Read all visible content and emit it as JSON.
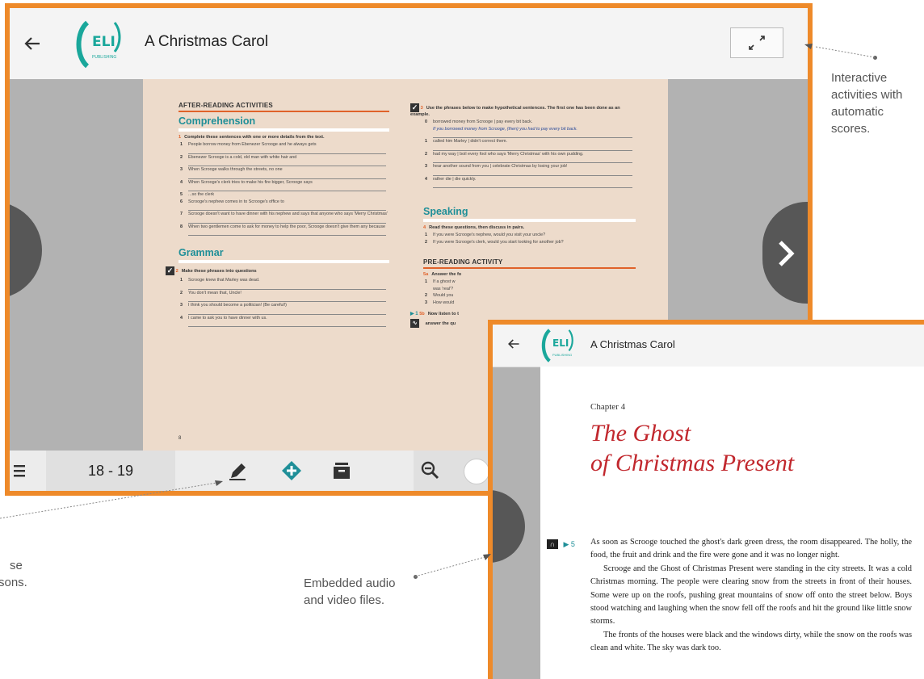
{
  "colors": {
    "frame": "#ee8a2a",
    "teal": "#1f8f98",
    "orange": "#e0622a",
    "ghost_red": "#c1272d"
  },
  "main_window": {
    "title": "A Christmas Carol",
    "back_icon": "arrow-left-icon",
    "logo_text": "ELI",
    "logo_sub": "PUBLISHING",
    "minimize_icon": "collapse-arrows-icon",
    "left_page": {
      "section": "AFTER-READING ACTIVITIES",
      "heading1": "Comprehension",
      "q1_num": "1",
      "q1_text": "Complete these sentences with one or more details from the text.",
      "q1_items": [
        {
          "n": "1",
          "t": "People borrow money from Ebenezer Scrooge and he always gets"
        },
        {
          "n": "2",
          "t": "Ebenezer Scrooge is a cold, old man with white hair and"
        },
        {
          "n": "3",
          "t": "When Scrooge walks through the streets, no one"
        },
        {
          "n": "4",
          "t": "When Scrooge's clerk tries to make his fire bigger, Scrooge says"
        },
        {
          "n": "5",
          "t": "...so the clerk"
        },
        {
          "n": "6",
          "t": "Scrooge's nephew comes in to Scrooge's office to"
        },
        {
          "n": "7",
          "t": "Scrooge doesn't want to have dinner with his nephew and says that anyone who says 'Merry Christmas'"
        },
        {
          "n": "8",
          "t": "When two gentlemen come to ask for money to help the poor, Scrooge doesn't give them any because"
        }
      ],
      "heading2": "Grammar",
      "q2_num": "2",
      "q2_text": "Make these phrases into questions",
      "q2_items": [
        {
          "n": "1",
          "t": "Scrooge knew that Marley was dead."
        },
        {
          "n": "2",
          "t": "You don't mean that, Uncle!"
        },
        {
          "n": "3",
          "t": "I think you should become a politician! (Be careful!)"
        },
        {
          "n": "4",
          "t": "I came to ask you to have dinner with us."
        }
      ],
      "page_number": "8"
    },
    "right_page": {
      "q3_num": "3",
      "q3_text": "Use the phrases below to make hypothetical sentences. The first one has been done as an example.",
      "q3_items": [
        {
          "n": "0",
          "t": "borrowed money from Scrooge | pay every bit back."
        },
        {
          "n": "",
          "t": "If you borrowed money from Scrooge, (then) you had to pay every bit back."
        },
        {
          "n": "1",
          "t": "called him Marley | didn't correct them."
        },
        {
          "n": "2",
          "t": "had my way | boil every fool who says 'Merry Christmas' with his own pudding."
        },
        {
          "n": "3",
          "t": "hear another sound from you | celebrate Christmas by losing your job!"
        },
        {
          "n": "4",
          "t": "rather die | die quickly."
        }
      ],
      "heading3": "Speaking",
      "q4_num": "4",
      "q4_text": "Read these questions, then discuss in pairs.",
      "q4_items": [
        {
          "n": "1",
          "t": "If you were Scrooge's nephew, would you visit your uncle?"
        },
        {
          "n": "2",
          "t": "If you were Scrooge's clerk, would you start looking for another job?"
        }
      ],
      "section2": "PRE-READING ACTIVITY",
      "q5a_num": "5a",
      "q5a_text": "Answer the fo",
      "q5a_items": [
        {
          "n": "1",
          "t": "If a ghost w"
        },
        {
          "n": "",
          "t": "was 'real'?"
        },
        {
          "n": "2",
          "t": "Would you"
        },
        {
          "n": "3",
          "t": "How would"
        }
      ],
      "q5b_track": "▶ 1",
      "q5b_num": "5b",
      "q5b_text": "Now listen to t",
      "q5b_text2": "answer the qu"
    },
    "bottom_bar": {
      "menu_icon": "hamburger-menu-icon",
      "pages": "18 - 19",
      "pencil_icon": "pencil-icon",
      "add_icon": "add-bookmark-icon",
      "archive_icon": "archive-icon",
      "zoom_out_icon": "zoom-out-icon"
    },
    "next_icon": "chevron-right-icon",
    "prev_icon": "chevron-left-icon"
  },
  "secondary_window": {
    "title": "A Christmas Carol",
    "logo_text": "ELI",
    "logo_sub": "PUBLISHING",
    "chapter": "Chapter 4",
    "heading_line1": "The Ghost",
    "heading_line2": "of Christmas Present",
    "audio_icon": "headphones-icon",
    "track": "▶ 5",
    "paragraphs": [
      "As soon as Scrooge touched the ghost's dark green dress, the room disappeared. The holly, the food, the fruit and drink and the fire were gone and it was no longer night.",
      "Scrooge and the Ghost of Christmas Present were standing in the city streets. It was a cold Christmas morning. The people were clearing snow from the streets in front of their houses. Some were up on the roofs, pushing great mountains of snow off onto the street below. Boys stood watching and laughing when the snow fell off the roofs and hit the ground like little snow storms.",
      "The fronts of the houses were black and the windows dirty, while the snow on the roofs was clean and white. The sky was dark too."
    ]
  },
  "callouts": {
    "interactive": [
      "Interactive",
      "activities with",
      "automatic",
      "scores."
    ],
    "embedded": [
      "Embedded audio",
      "and video files."
    ],
    "left_partial": [
      "se",
      "sons."
    ]
  }
}
